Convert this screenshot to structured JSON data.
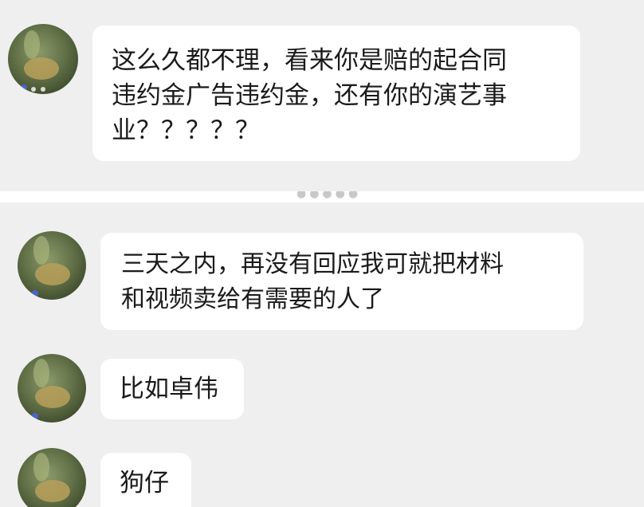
{
  "chat": {
    "messages": [
      {
        "sender": "other",
        "text": "这么久都不理，看来你是赔的起合同\n违约金广告违约金，还有你的演艺事\n业？？？？？"
      },
      {
        "sender": "other",
        "text": "三天之内，再没有回应我可就把材料\n和视频卖给有需要的人了"
      },
      {
        "sender": "other",
        "text": "比如卓伟"
      },
      {
        "sender": "other",
        "text": "狗仔"
      }
    ]
  },
  "colors": {
    "background": "#efefef",
    "bubble": "#ffffff",
    "text": "#1a1a1a",
    "avatar_main": "#6d7a4e"
  },
  "icons": {
    "avatar": "avatar-image"
  }
}
